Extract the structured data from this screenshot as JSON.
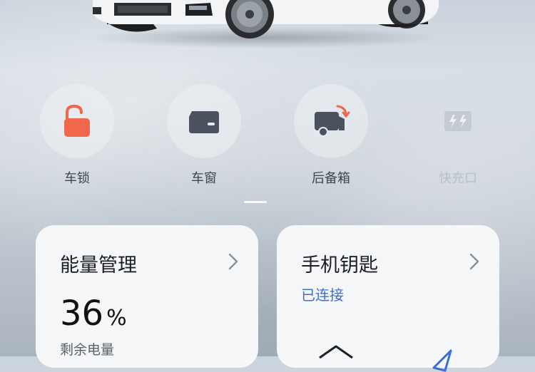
{
  "controls": [
    {
      "label": "车锁",
      "icon": "unlocked-icon",
      "state": "unlocked"
    },
    {
      "label": "车窗",
      "icon": "window-icon"
    },
    {
      "label": "后备箱",
      "icon": "trunk-icon"
    },
    {
      "label": "快充口",
      "icon": "fast-charge-icon",
      "disabled": true
    }
  ],
  "energy_card": {
    "title": "能量管理",
    "value": "36",
    "unit": "%",
    "sublabel": "剩余电量"
  },
  "key_card": {
    "title": "手机钥匙",
    "status": "已连接"
  },
  "colors": {
    "lock_accent": "#f0674c",
    "icon_dark": "#4a5260",
    "status_blue": "#3a6fd8"
  }
}
